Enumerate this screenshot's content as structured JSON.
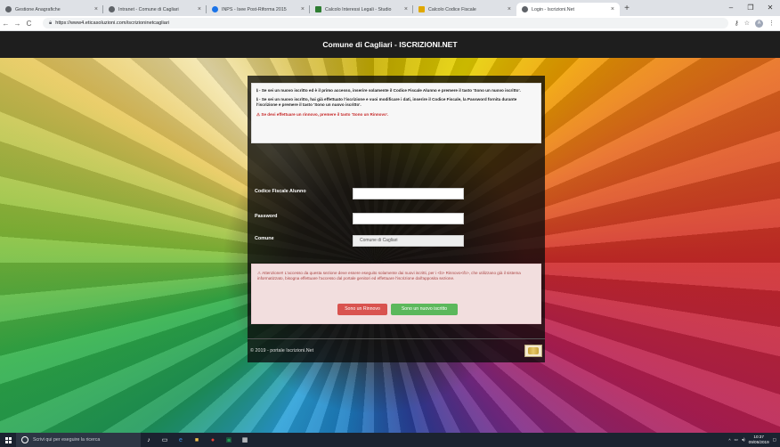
{
  "browser": {
    "tabs": [
      {
        "title": "Gestione Anagrafiche",
        "color": "#5f6368"
      },
      {
        "title": "Intranet - Comune di Cagliari",
        "color": "#5f6368"
      },
      {
        "title": "INPS - Isee Post-Riforma 2015",
        "color": "#1a73e8"
      },
      {
        "title": "Calcolo Interessi Legali - Studio",
        "color": "#2e7d32"
      },
      {
        "title": "Calcolo Codice Fiscale",
        "color": "#e0a800"
      },
      {
        "title": "Login - Iscrizioni.Net",
        "color": "#5f6368",
        "active": true
      }
    ],
    "new_tab": "+",
    "url": "https://www4.eticasoluzioni.com/iscrizioninetcagliari",
    "profile_initial": "A"
  },
  "header": {
    "title": "Comune di Cagliari - ISCRIZIONI.NET"
  },
  "info": {
    "line1": "ℹ - Se sei un nuovo iscritto ed è il primo accesso, inserire solamente il Codice Fiscale Alunno e premere il tasto 'Sono un nuovo iscritto'.",
    "line2": "ℹ - Se sei un nuovo iscritto, hai già effettuato l'iscrizione e vuoi modificare i dati, inserire il Codice Fiscale, la Password fornita durante l'iscrizione e premere il tasto 'Sono un nuovo iscritto'.",
    "line3": "⚠ Se devi effettuare un rinnovo, premere il tasto 'Sono un Rinnovo'."
  },
  "form": {
    "codice_label": "Codice Fiscale Alunno",
    "codice_value": "",
    "password_label": "Password",
    "password_value": "",
    "comune_label": "Comune",
    "comune_value": "Comune di Cagliari"
  },
  "alert": {
    "text": "⚠ Attenzione!! L'accesso da questa sezione deve essere eseguito solamente dai nuovi iscritti, per i <b> Rinnovo</b>, che utilizzano già il sistema informatizzato, bisogna effettuare l'accesso dal portale genitori ed effettuare l'iscrizione dall'apposita sezione."
  },
  "buttons": {
    "rinnovo": "Sono un Rinnovo",
    "nuovo": "Sono un nuovo iscritto"
  },
  "footer": {
    "text": "© 2019 - portale Iscrizioni.Net"
  },
  "taskbar": {
    "search_placeholder": "Scrivi qui per eseguire la ricerca",
    "time": "10:37",
    "date": "09/05/2019"
  }
}
